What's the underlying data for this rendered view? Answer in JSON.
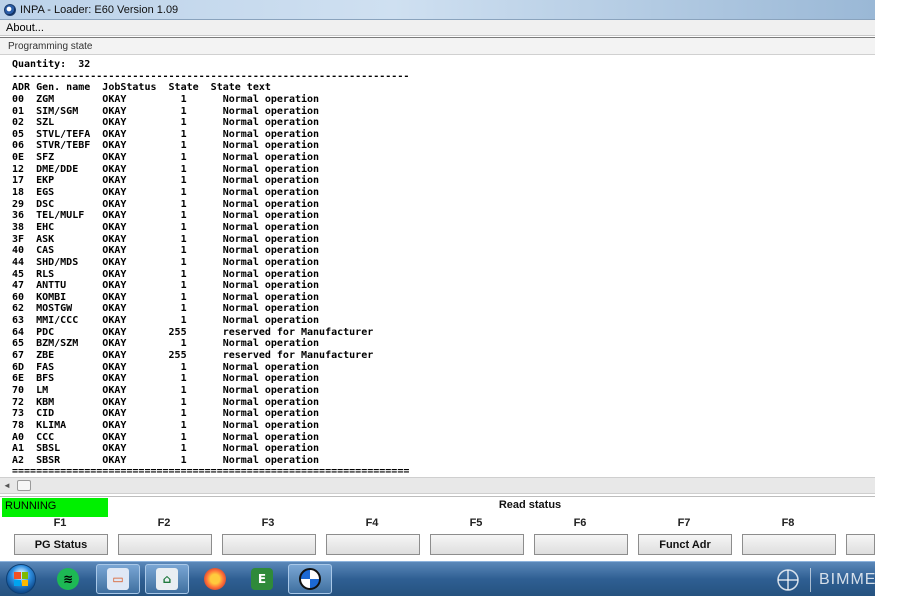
{
  "window": {
    "title": "INPA - Loader: E60 Version 1.09"
  },
  "menu": {
    "about": "About..."
  },
  "section": {
    "title": "Programming state"
  },
  "content": {
    "quantity_line": "Quantity:  32",
    "separator_top": "------------------------------------------------------------------",
    "header": {
      "adr": "ADR",
      "name": "Gen. name",
      "job": "JobStatus",
      "state": "State",
      "text": "State text"
    },
    "rows": [
      {
        "adr": "00",
        "name": "ZGM",
        "job": "OKAY",
        "state": "1",
        "text": "Normal operation"
      },
      {
        "adr": "01",
        "name": "SIM/SGM",
        "job": "OKAY",
        "state": "1",
        "text": "Normal operation"
      },
      {
        "adr": "02",
        "name": "SZL",
        "job": "OKAY",
        "state": "1",
        "text": "Normal operation"
      },
      {
        "adr": "05",
        "name": "STVL/TEFA",
        "job": "OKAY",
        "state": "1",
        "text": "Normal operation"
      },
      {
        "adr": "06",
        "name": "STVR/TEBF",
        "job": "OKAY",
        "state": "1",
        "text": "Normal operation"
      },
      {
        "adr": "0E",
        "name": "SFZ",
        "job": "OKAY",
        "state": "1",
        "text": "Normal operation"
      },
      {
        "adr": "12",
        "name": "DME/DDE",
        "job": "OKAY",
        "state": "1",
        "text": "Normal operation"
      },
      {
        "adr": "17",
        "name": "EKP",
        "job": "OKAY",
        "state": "1",
        "text": "Normal operation"
      },
      {
        "adr": "18",
        "name": "EGS",
        "job": "OKAY",
        "state": "1",
        "text": "Normal operation"
      },
      {
        "adr": "29",
        "name": "DSC",
        "job": "OKAY",
        "state": "1",
        "text": "Normal operation"
      },
      {
        "adr": "36",
        "name": "TEL/MULF",
        "job": "OKAY",
        "state": "1",
        "text": "Normal operation"
      },
      {
        "adr": "38",
        "name": "EHC",
        "job": "OKAY",
        "state": "1",
        "text": "Normal operation"
      },
      {
        "adr": "3F",
        "name": "ASK",
        "job": "OKAY",
        "state": "1",
        "text": "Normal operation"
      },
      {
        "adr": "40",
        "name": "CAS",
        "job": "OKAY",
        "state": "1",
        "text": "Normal operation"
      },
      {
        "adr": "44",
        "name": "SHD/MDS",
        "job": "OKAY",
        "state": "1",
        "text": "Normal operation"
      },
      {
        "adr": "45",
        "name": "RLS",
        "job": "OKAY",
        "state": "1",
        "text": "Normal operation"
      },
      {
        "adr": "47",
        "name": "ANTTU",
        "job": "OKAY",
        "state": "1",
        "text": "Normal operation"
      },
      {
        "adr": "60",
        "name": "KOMBI",
        "job": "OKAY",
        "state": "1",
        "text": "Normal operation"
      },
      {
        "adr": "62",
        "name": "MOSTGW",
        "job": "OKAY",
        "state": "1",
        "text": "Normal operation"
      },
      {
        "adr": "63",
        "name": "MMI/CCC",
        "job": "OKAY",
        "state": "1",
        "text": "Normal operation"
      },
      {
        "adr": "64",
        "name": "PDC",
        "job": "OKAY",
        "state": "255",
        "text": "reserved for Manufacturer"
      },
      {
        "adr": "65",
        "name": "BZM/SZM",
        "job": "OKAY",
        "state": "1",
        "text": "Normal operation"
      },
      {
        "adr": "67",
        "name": "ZBE",
        "job": "OKAY",
        "state": "255",
        "text": "reserved for Manufacturer"
      },
      {
        "adr": "6D",
        "name": "FAS",
        "job": "OKAY",
        "state": "1",
        "text": "Normal operation"
      },
      {
        "adr": "6E",
        "name": "BFS",
        "job": "OKAY",
        "state": "1",
        "text": "Normal operation"
      },
      {
        "adr": "70",
        "name": "LM",
        "job": "OKAY",
        "state": "1",
        "text": "Normal operation"
      },
      {
        "adr": "72",
        "name": "KBM",
        "job": "OKAY",
        "state": "1",
        "text": "Normal operation"
      },
      {
        "adr": "73",
        "name": "CID",
        "job": "OKAY",
        "state": "1",
        "text": "Normal operation"
      },
      {
        "adr": "78",
        "name": "KLIMA",
        "job": "OKAY",
        "state": "1",
        "text": "Normal operation"
      },
      {
        "adr": "A0",
        "name": "CCC",
        "job": "OKAY",
        "state": "1",
        "text": "Normal operation"
      },
      {
        "adr": "A1",
        "name": "SBSL",
        "job": "OKAY",
        "state": "1",
        "text": "Normal operation"
      },
      {
        "adr": "A2",
        "name": "SBSR",
        "job": "OKAY",
        "state": "1",
        "text": "Normal operation"
      }
    ],
    "separator_bottom": "=================================================================="
  },
  "status": {
    "running": "RUNNING",
    "text": "Read status",
    "running_color": "#00f000"
  },
  "fkeys": [
    {
      "key": "F1",
      "label": "PG Status"
    },
    {
      "key": "F2",
      "label": ""
    },
    {
      "key": "F3",
      "label": ""
    },
    {
      "key": "F4",
      "label": ""
    },
    {
      "key": "F5",
      "label": ""
    },
    {
      "key": "F6",
      "label": ""
    },
    {
      "key": "F7",
      "label": "Funct Adr"
    },
    {
      "key": "F8",
      "label": ""
    }
  ],
  "taskbar": {
    "items": [
      "start-orb",
      "spotify-icon",
      "remote-desktop-icon",
      "store-icon",
      "firefox-icon",
      "ediabas-icon",
      "bmw-icon"
    ],
    "watermark": "BIMME"
  }
}
